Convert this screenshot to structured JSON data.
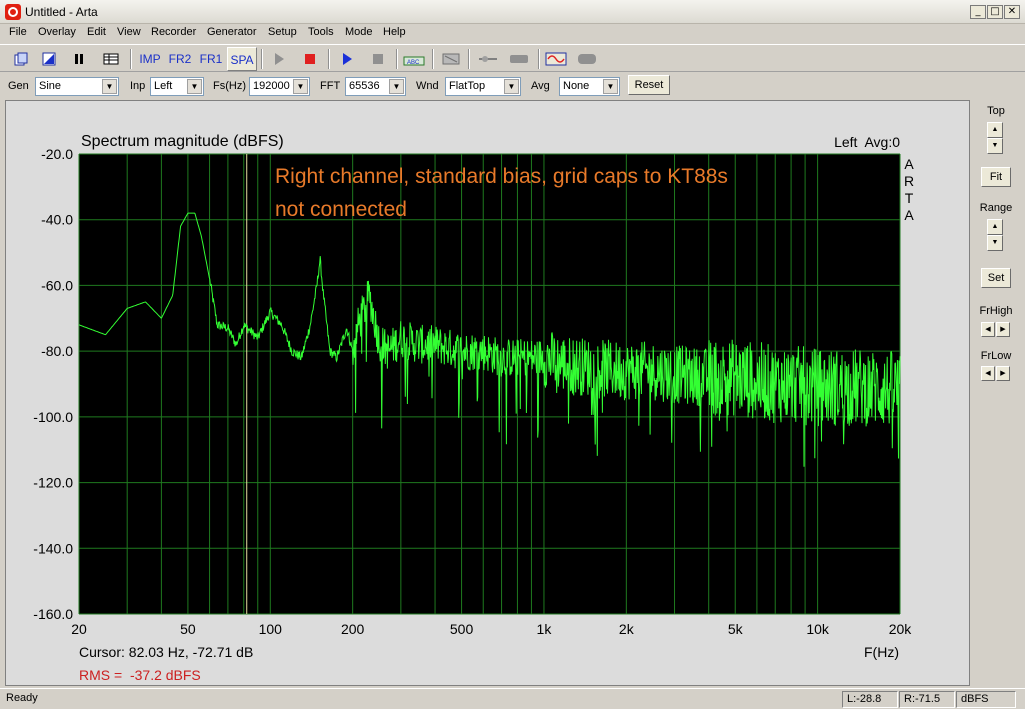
{
  "window": {
    "title": "Untitled - Arta",
    "minimize": "_",
    "maximize": "□",
    "close": "✕"
  },
  "menu": [
    "File",
    "Overlay",
    "Edit",
    "View",
    "Recorder",
    "Generator",
    "Setup",
    "Tools",
    "Mode",
    "Help"
  ],
  "toolbar": {
    "imp": "IMP",
    "fr2": "FR2",
    "fr1": "FR1",
    "spa": "SPA"
  },
  "controls": {
    "gen_label": "Gen",
    "gen_value": "Sine",
    "inp_label": "Inp",
    "inp_value": "Left",
    "fs_label": "Fs(Hz)",
    "fs_value": "192000",
    "fft_label": "FFT",
    "fft_value": "65536",
    "wnd_label": "Wnd",
    "wnd_value": "FlatTop",
    "avg_label": "Avg",
    "avg_value": "None",
    "reset": "Reset"
  },
  "side": {
    "top": "Top",
    "fit": "Fit",
    "range": "Range",
    "set": "Set",
    "frhigh": "FrHigh",
    "frlow": "FrLow"
  },
  "plot": {
    "channel_info": "Left  Avg:0",
    "annotation_line1": "Right channel, standard bias, grid caps to KT88s",
    "annotation_line2": "not connected",
    "watermark": [
      "A",
      "R",
      "T",
      "A"
    ],
    "cursor_text": "Cursor: 82.03 Hz, -72.71 dB",
    "rms_text": "RMS =  -37.2 dBFS",
    "colors": {
      "background": "#000000",
      "grid": "#1f7a1f",
      "trace": "#33ff33",
      "cursor": "#e8e0a0",
      "annotation": "#e87a2a",
      "rms": "#cc2020"
    }
  },
  "chart_data": {
    "type": "line",
    "title": "Spectrum magnitude (dBFS)",
    "xlabel": "F(Hz)",
    "ylabel": "",
    "x_scale": "log",
    "xlim": [
      20,
      20000
    ],
    "ylim": [
      -160,
      -20
    ],
    "x_ticks": [
      20,
      50,
      100,
      200,
      500,
      1000,
      2000,
      5000,
      10000,
      20000
    ],
    "x_tick_labels": [
      "20",
      "50",
      "100",
      "200",
      "500",
      "1k",
      "2k",
      "5k",
      "10k",
      "20k"
    ],
    "y_ticks": [
      -20,
      -40,
      -60,
      -80,
      -100,
      -120,
      -140,
      -160
    ],
    "y_tick_labels": [
      "-20.0",
      "-40.0",
      "-60.0",
      "-80.0",
      "-100.0",
      "-120.0",
      "-140.0",
      "-160.0"
    ],
    "cursor_x": 82.03,
    "grid": true,
    "series": [
      {
        "x": [
          20,
          25,
          30,
          35,
          40,
          44,
          47,
          50,
          53,
          56,
          60,
          64,
          70,
          75,
          80,
          90,
          100,
          110,
          120,
          130,
          140,
          148,
          152,
          156,
          165,
          175,
          190,
          200,
          210,
          230,
          250,
          270,
          300,
          350,
          400,
          500,
          600,
          700,
          800,
          1000,
          1200,
          1500,
          2000,
          2500,
          3000,
          4000,
          5000,
          6000,
          7000,
          8000,
          10000,
          12000,
          15000,
          20000
        ],
        "y": [
          -72,
          -75,
          -67,
          -65,
          -70,
          -63,
          -42,
          -38,
          -38,
          -45,
          -58,
          -72,
          -73,
          -78,
          -72,
          -76,
          -68,
          -72,
          -80,
          -82,
          -72,
          -60,
          -52,
          -62,
          -80,
          -82,
          -73,
          -80,
          -72,
          -63,
          -77,
          -80,
          -76,
          -78,
          -78,
          -80,
          -80,
          -82,
          -82,
          -82,
          -84,
          -85,
          -86,
          -86,
          -87,
          -88,
          -88,
          -89,
          -90,
          -90,
          -91,
          -91,
          -91,
          -92
        ]
      }
    ]
  },
  "status": {
    "ready": "Ready",
    "level_l": "L:-28.8",
    "level_r": "R:-71.5",
    "unit": "dBFS"
  }
}
